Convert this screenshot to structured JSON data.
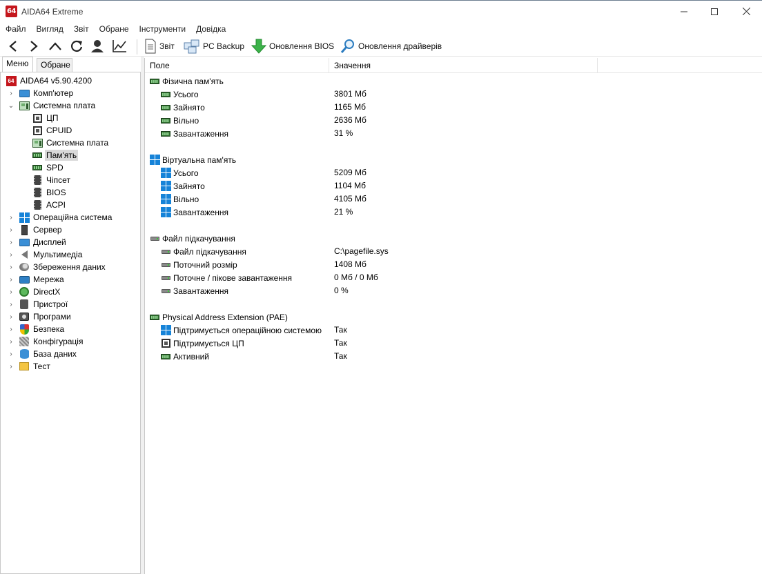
{
  "window": {
    "title": "AIDA64 Extreme",
    "logo_text": "64"
  },
  "menu": [
    "Файл",
    "Вигляд",
    "Звіт",
    "Обране",
    "Інструменти",
    "Довідка"
  ],
  "toolbar": {
    "report_label": "Звіт",
    "backup_label": "PC Backup",
    "bios_label": "Оновлення BIOS",
    "drivers_label": "Оновлення драйверів"
  },
  "sidebar": {
    "tabs": [
      "Меню",
      "Обране"
    ],
    "root_label": "AIDA64 v5.90.4200",
    "items": [
      {
        "label": "Комп'ютер",
        "icon": "monitor-icon"
      },
      {
        "label": "Системна плата",
        "icon": "motherboard-icon",
        "expanded": true
      },
      {
        "label": "ЦП",
        "icon": "cpu-icon"
      },
      {
        "label": "CPUID",
        "icon": "cpu-icon"
      },
      {
        "label": "Системна плата",
        "icon": "motherboard-icon"
      },
      {
        "label": "Пам'ять",
        "icon": "ram-icon",
        "selected": true
      },
      {
        "label": "SPD",
        "icon": "ram-icon"
      },
      {
        "label": "Чіпсет",
        "icon": "chip-icon"
      },
      {
        "label": "BIOS",
        "icon": "chip-icon"
      },
      {
        "label": "ACPI",
        "icon": "chip-icon"
      },
      {
        "label": "Операційна система",
        "icon": "windows-icon"
      },
      {
        "label": "Сервер",
        "icon": "server-icon"
      },
      {
        "label": "Дисплей",
        "icon": "monitor-icon"
      },
      {
        "label": "Мультимедіа",
        "icon": "speaker-icon"
      },
      {
        "label": "Збереження даних",
        "icon": "hdd-icon"
      },
      {
        "label": "Мережа",
        "icon": "network-icon"
      },
      {
        "label": "DirectX",
        "icon": "xbox-icon"
      },
      {
        "label": "Пристрої",
        "icon": "devices-icon"
      },
      {
        "label": "Програми",
        "icon": "programs-icon"
      },
      {
        "label": "Безпека",
        "icon": "shield-icon"
      },
      {
        "label": "Конфігурація",
        "icon": "config-icon"
      },
      {
        "label": "База даних",
        "icon": "database-icon"
      },
      {
        "label": "Тест",
        "icon": "test-icon"
      }
    ]
  },
  "columns": {
    "field": "Поле",
    "value": "Значення"
  },
  "sections": [
    {
      "title": "Фізична пам'ять",
      "icon": "ram-icon",
      "rows": [
        {
          "field": "Усього",
          "value": "3801 Мб"
        },
        {
          "field": "Зайнято",
          "value": "1165 Мб"
        },
        {
          "field": "Вільно",
          "value": "2636 Мб"
        },
        {
          "field": "Завантаження",
          "value": "31 %"
        }
      ]
    },
    {
      "title": "Віртуальна пам'ять",
      "icon": "windows-icon",
      "rows": [
        {
          "field": "Усього",
          "value": "5209 Мб"
        },
        {
          "field": "Зайнято",
          "value": "1104 Мб"
        },
        {
          "field": "Вільно",
          "value": "4105 Мб"
        },
        {
          "field": "Завантаження",
          "value": "21 %"
        }
      ]
    },
    {
      "title": "Файл підкачування",
      "icon": "disk-icon",
      "rows": [
        {
          "field": "Файл підкачування",
          "value": "C:\\pagefile.sys"
        },
        {
          "field": "Поточний розмір",
          "value": "1408 Мб"
        },
        {
          "field": "Поточне / пікове завантаження",
          "value": "0 Мб / 0 Мб"
        },
        {
          "field": "Завантаження",
          "value": "0 %"
        }
      ]
    },
    {
      "title": "Physical Address Extension (PAE)",
      "icon": "ram-icon",
      "rows": [
        {
          "field": "Підтримується операційною системою",
          "value": "Так",
          "icon": "windows-icon"
        },
        {
          "field": "Підтримується ЦП",
          "value": "Так",
          "icon": "cpu-icon"
        },
        {
          "field": "Активний",
          "value": "Так",
          "icon": "ram-icon"
        }
      ]
    }
  ]
}
